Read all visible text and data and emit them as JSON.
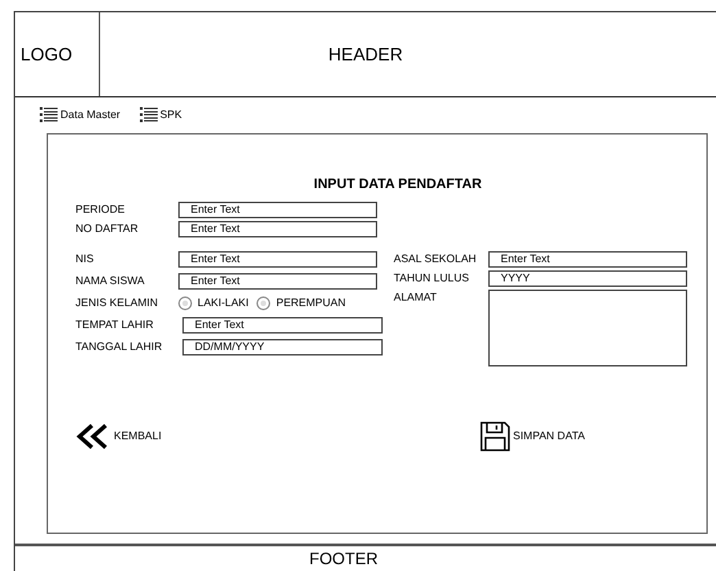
{
  "header": {
    "logo": "LOGO",
    "title": "HEADER"
  },
  "menu": [
    {
      "label": "Data Master"
    },
    {
      "label": "SPK"
    }
  ],
  "form": {
    "title": "INPUT DATA PENDAFTAR",
    "top_fields": [
      {
        "label": "PERIODE",
        "placeholder": "Enter Text"
      },
      {
        "label": "NO DAFTAR",
        "placeholder": "Enter Text"
      }
    ],
    "left_fields": [
      {
        "label": "NIS",
        "kind": "text",
        "placeholder": "Enter Text"
      },
      {
        "label": "NAMA SISWA",
        "kind": "text",
        "placeholder": "Enter Text"
      },
      {
        "label": "JENIS KELAMIN",
        "kind": "radio",
        "options": [
          {
            "label": "LAKI-LAKI",
            "selected": false
          },
          {
            "label": "PEREMPUAN",
            "selected": false
          }
        ]
      },
      {
        "label": "TEMPAT LAHIR",
        "kind": "text",
        "placeholder": "Enter Text"
      },
      {
        "label": "TANGGAL LAHIR",
        "kind": "text",
        "placeholder": "DD/MM/YYYY"
      }
    ],
    "right_fields": [
      {
        "label": "ASAL SEKOLAH",
        "kind": "text",
        "placeholder": "Enter Text"
      },
      {
        "label": "TAHUN LULUS",
        "kind": "text",
        "placeholder": "YYYY"
      },
      {
        "label": "ALAMAT",
        "kind": "textarea"
      }
    ],
    "back_button": "KEMBALI",
    "save_button": "SIMPAN DATA"
  },
  "footer": "FOOTER"
}
